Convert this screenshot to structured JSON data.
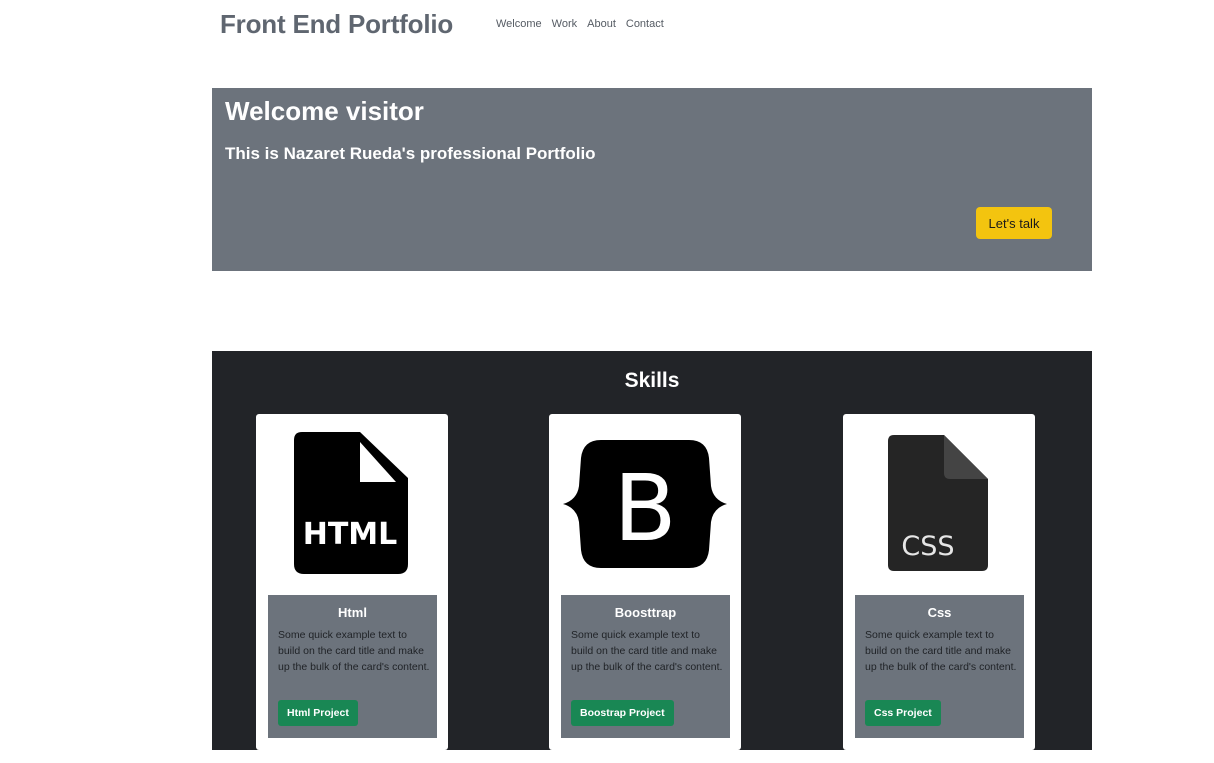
{
  "nav": {
    "brand": "Front End Portfolio",
    "links": [
      "Welcome",
      "Work",
      "About",
      "Contact"
    ]
  },
  "hero": {
    "title": "Welcome visitor",
    "subtitle": "This is Nazaret Rueda's professional Portfolio",
    "button_label": "Let's talk",
    "bg_color": "#6c737c",
    "button_color": "#f3c40f"
  },
  "skills": {
    "title": "Skills",
    "bg_color": "#222428",
    "cards": [
      {
        "icon": "html-file-icon",
        "icon_text": "HTML",
        "title": "Html",
        "text": "Some quick example text to build on the card title and make up the bulk of the card's content.",
        "button_label": "Html Project"
      },
      {
        "icon": "bootstrap-icon",
        "icon_text": "B",
        "title": "Boosttrap",
        "text": "Some quick example text to build on the card title and make up the bulk of the card's content.",
        "button_label": "Boostrap Project"
      },
      {
        "icon": "css-file-icon",
        "icon_text": "CSS",
        "title": "Css",
        "text": "Some quick example text to build on the card title and make up the bulk of the card's content.",
        "button_label": "Css Project"
      }
    ],
    "button_color": "#198754"
  }
}
